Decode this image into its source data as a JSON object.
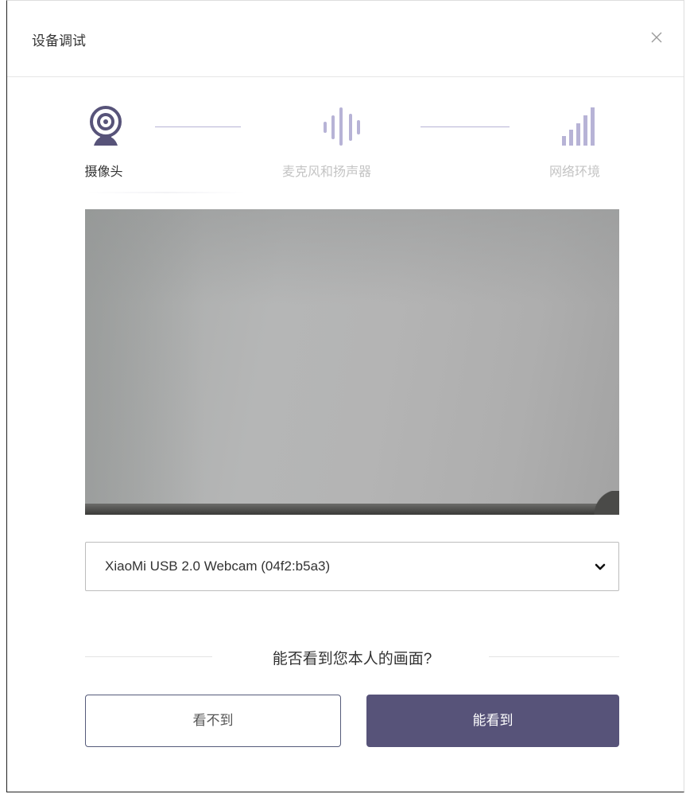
{
  "dialog": {
    "title": "设备调试",
    "close_icon": "close-icon"
  },
  "stepper": {
    "steps": [
      {
        "label": "摄像头",
        "icon": "webcam-icon",
        "state": "active"
      },
      {
        "label": "麦克风和扬声器",
        "icon": "sound-wave-icon",
        "state": "inactive"
      },
      {
        "label": "网络环境",
        "icon": "signal-bars-icon",
        "state": "inactive"
      }
    ]
  },
  "camera": {
    "selected_device": "XiaoMi USB 2.0 Webcam (04f2:b5a3)"
  },
  "question": {
    "text": "能否看到您本人的画面?"
  },
  "actions": {
    "cannot_see_label": "看不到",
    "can_see_label": "能看到"
  },
  "colors": {
    "accent": "#575379",
    "accent_light": "#b7b3d6",
    "inactive_text": "#c4c4c4"
  }
}
